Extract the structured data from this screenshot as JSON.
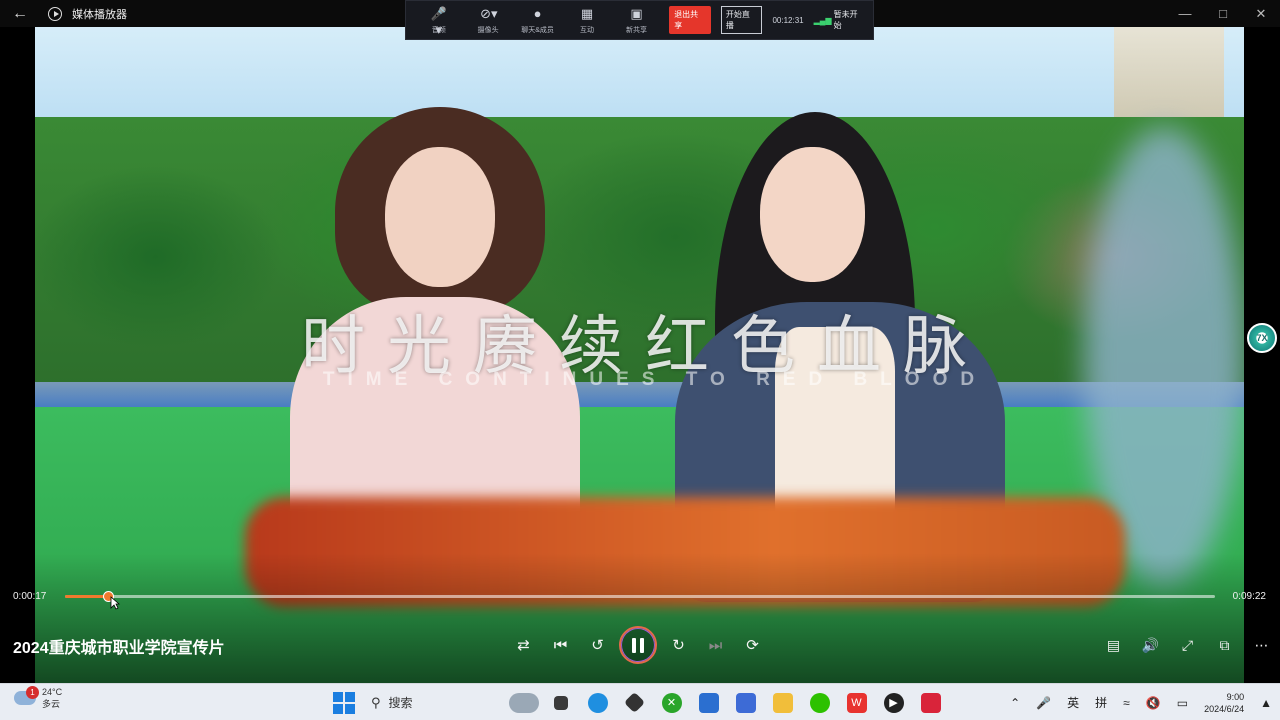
{
  "window": {
    "title": "媒体播放器"
  },
  "meeting_toolbar": {
    "items": [
      {
        "label": "音频",
        "icon": "mic-icon"
      },
      {
        "label": "摄像头",
        "icon": "camera-off-icon"
      },
      {
        "label": "聊天&成员",
        "icon": "members-icon"
      },
      {
        "label": "互动",
        "icon": "grid-icon"
      },
      {
        "label": "新共享",
        "icon": "share-icon"
      }
    ],
    "stop_share": "退出共享",
    "start_live": "开始直播",
    "elapsed": "00:12:31",
    "status": "暂未开始"
  },
  "video": {
    "caption_cn": "时光赓续红色血脉",
    "caption_en": "TIME CONTINUES TO RED BLOOD",
    "title": "2024重庆城市职业学院宣传片",
    "current_time": "0:00:17",
    "total_time": "0:09:22",
    "progress": 0.037
  },
  "controls": {
    "shuffle": "shuffle-icon",
    "previous": "previous-icon",
    "rewind": "rewind-10-icon",
    "play_pause": "pause-icon",
    "forward": "forward-30-icon",
    "next": "next-icon",
    "repeat": "repeat-icon"
  },
  "side_widget": {
    "label": "7X"
  },
  "taskbar": {
    "weather": {
      "temp": "24°C",
      "condition": "多云",
      "badge": "1"
    },
    "search_placeholder": "搜索",
    "tray": {
      "lang": "英",
      "ime": "拼"
    },
    "clock": {
      "time": "9:00",
      "date": "2024/6/24"
    }
  },
  "colors": {
    "accent": "#f07a2e",
    "stop_red": "#e5362b",
    "taskbar_bg": "#e9edf3"
  }
}
